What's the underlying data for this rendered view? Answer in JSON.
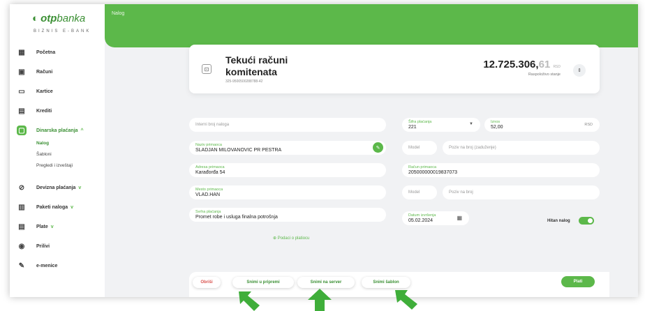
{
  "brand": {
    "logo_text": "otpbanka",
    "logo_bold": "otp",
    "logo_light": "banka",
    "subtitle": "BIZNIS E-BANK"
  },
  "header": {
    "title": "Nalog"
  },
  "sidebar": {
    "items": [
      {
        "label": "Početna",
        "icon": "dashboard-icon",
        "glyph": "▦"
      },
      {
        "label": "Računi",
        "icon": "accounts-icon",
        "glyph": "▣"
      },
      {
        "label": "Kartice",
        "icon": "card-icon",
        "glyph": "▭"
      },
      {
        "label": "Krediti",
        "icon": "loan-icon",
        "glyph": "▤"
      },
      {
        "label": "Dinarska plaćanja",
        "icon": "payment-icon",
        "glyph": "▢"
      },
      {
        "label": "Devizna plaćanja",
        "icon": "foreign-payment-icon",
        "glyph": "⊘"
      },
      {
        "label": "Paketi naloga",
        "icon": "package-icon",
        "glyph": "▥"
      },
      {
        "label": "Plate",
        "icon": "salary-icon",
        "glyph": "▤"
      },
      {
        "label": "Prilivi",
        "icon": "inflow-icon",
        "glyph": "◉"
      },
      {
        "label": "e-menice",
        "icon": "promissory-icon",
        "glyph": "✎"
      }
    ],
    "subitems": [
      "Nalog",
      "Šabloni",
      "Pregledi i izveštaji"
    ],
    "chevron": "^",
    "chevron_down": "v"
  },
  "account": {
    "title": "Tekući računi komitenata",
    "number": "325-9500500288788-42",
    "amount_int": "12.725.306,",
    "amount_dec": "61",
    "currency": "RSD",
    "available_label": "Raspoloživo stanje",
    "icon_glyph": "⊡",
    "toggle_glyph": "⇕"
  },
  "form": {
    "internal_number_placeholder": "Interni broj naloga",
    "recipient_label": "Naziv primaoca",
    "recipient_value": "SLADJAN MILOVANOVIC PR PESTRA",
    "address_label": "Adresa primaoca",
    "address_value": "Karađorđa 54",
    "city_label": "Mesto primaoca",
    "city_value": "VLAD.HAN",
    "purpose_label": "Svrha plaćanja",
    "purpose_value": "Promet robe i usluga finalna potrošnja",
    "payment_code_label": "Šifra plaćanja",
    "payment_code_value": "221",
    "amount_label": "Iznos",
    "amount_value": "52,00",
    "amount_currency": "RSD",
    "model_placeholder": "Model",
    "debit_ref_placeholder": "Poziv na broj (zaduženje)",
    "account_label": "Račun primaoca",
    "account_value": "205000000019837073",
    "model2_placeholder": "Model",
    "ref_placeholder": "Poziv na broj",
    "date_label": "Datum izvršenja",
    "date_value": "05.02.2024",
    "urgent_label": "Hitan nalog",
    "urgent_on": true,
    "payer_link": "⊕ Podaci o platiocu"
  },
  "actions": {
    "delete": "Obriši",
    "save_prep": "Snimi u pripremi",
    "save_server": "Snimi na server",
    "save_template": "Snimi šablon",
    "pay": "Plati"
  },
  "colors": {
    "brand_green": "#5cb84a",
    "arrow_green": "#3fae3a"
  }
}
